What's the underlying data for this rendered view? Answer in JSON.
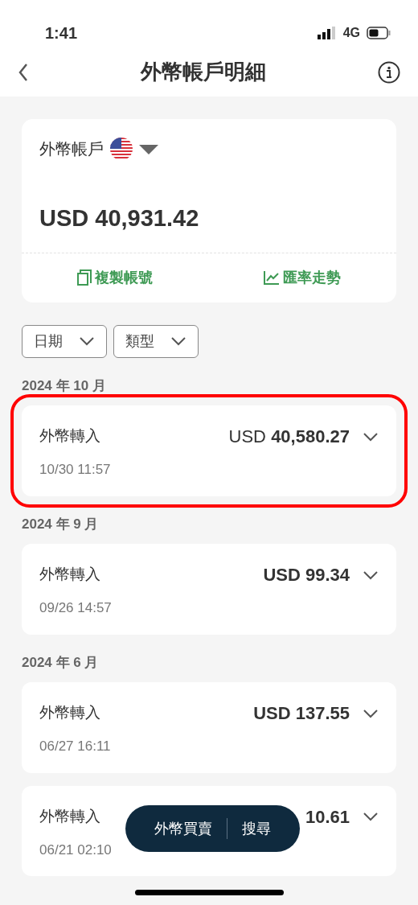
{
  "status_bar": {
    "time": "1:41",
    "network": "4G"
  },
  "header": {
    "title": "外幣帳戶明細"
  },
  "account": {
    "label": "外幣帳戶",
    "balance": "USD 40,931.42",
    "actions": [
      {
        "kind": "copy",
        "label": "複製帳號"
      },
      {
        "kind": "chart",
        "label": "匯率走勢"
      }
    ]
  },
  "filters": [
    {
      "label": "日期"
    },
    {
      "label": "類型"
    }
  ],
  "groups": [
    {
      "month": "2024 年 10 月",
      "transactions": [
        {
          "type": "外幣轉入",
          "amount": "USD **40,580.27**",
          "datetime": "10/30 11:57",
          "highlighted": true
        }
      ]
    },
    {
      "month": "2024 年 9 月",
      "transactions": [
        {
          "type": "外幣轉入",
          "amount": "**USD 99.34**",
          "datetime": "09/26 14:57",
          "highlighted": false
        }
      ]
    },
    {
      "month": "2024 年 6 月",
      "transactions": [
        {
          "type": "外幣轉入",
          "amount": "**USD 137.55**",
          "datetime": "06/27 16:11",
          "highlighted": false
        },
        {
          "type": "外幣轉入",
          "amount": "**10.61**",
          "datetime": "06/21 02:10",
          "highlighted": false
        }
      ]
    }
  ],
  "floating_bar": {
    "buttons": [
      "外幣買賣",
      "搜尋"
    ]
  }
}
